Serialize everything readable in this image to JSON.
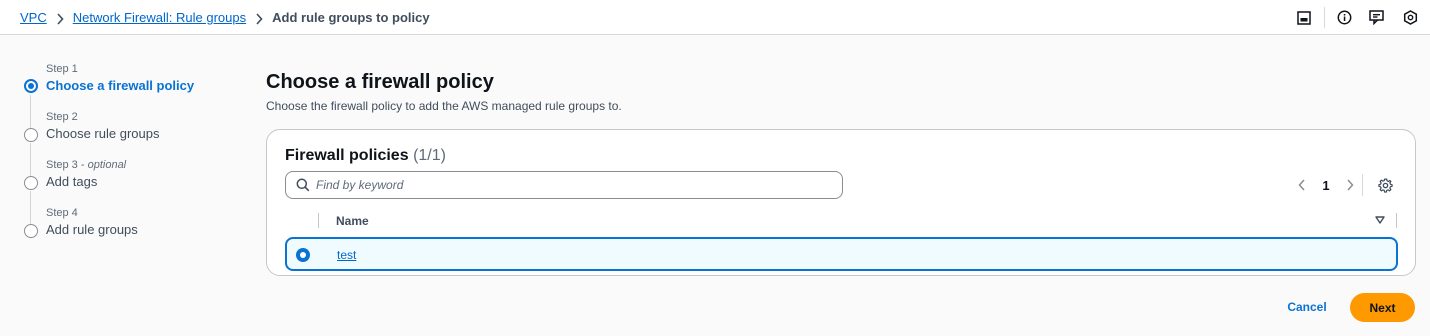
{
  "breadcrumb": {
    "items": [
      "VPC",
      "Network Firewall: Rule groups"
    ],
    "current": "Add rule groups to policy"
  },
  "utilities": [
    "panel-icon",
    "info-icon",
    "feedback-icon",
    "help-icon"
  ],
  "steps": [
    {
      "number": "Step 1",
      "optional": "",
      "label": "Choose a firewall policy",
      "active": true
    },
    {
      "number": "Step 2",
      "optional": "",
      "label": "Choose rule groups",
      "active": false
    },
    {
      "number": "Step 3",
      "optional": "optional",
      "label": "Add tags",
      "active": false
    },
    {
      "number": "Step 4",
      "optional": "",
      "label": "Add rule groups",
      "active": false
    }
  ],
  "page": {
    "title": "Choose a firewall policy",
    "description": "Choose the firewall policy to add the AWS managed rule groups to."
  },
  "table": {
    "title": "Firewall policies",
    "count": "(1/1)",
    "search_placeholder": "Find by keyword",
    "page_number": "1",
    "columns": [
      "Name"
    ],
    "rows": [
      {
        "name": "test",
        "selected": true
      }
    ]
  },
  "actions": {
    "cancel": "Cancel",
    "next": "Next"
  },
  "colors": {
    "accent": "#0972d3",
    "primary_button": "#ff9900",
    "link": "#0066cc"
  }
}
